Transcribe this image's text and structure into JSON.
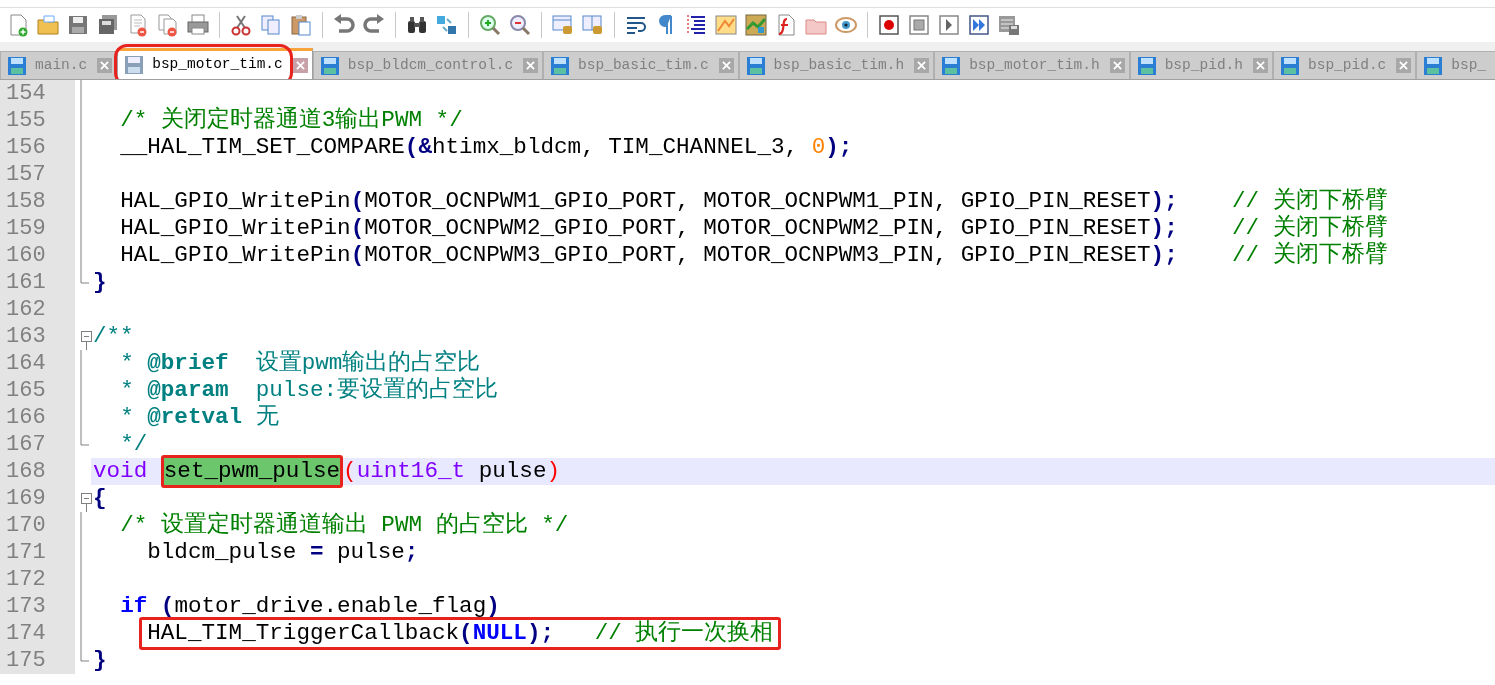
{
  "tabs": [
    {
      "label": "main.c",
      "selected": false,
      "annotated": false,
      "close_button": true
    },
    {
      "label": "bsp_motor_tim.c",
      "selected": true,
      "annotated": true,
      "close_button": true
    },
    {
      "label": "bsp_bldcm_control.c",
      "selected": false,
      "annotated": false,
      "close_button": true
    },
    {
      "label": "bsp_basic_tim.c",
      "selected": false,
      "annotated": false,
      "close_button": true
    },
    {
      "label": "bsp_basic_tim.h",
      "selected": false,
      "annotated": false,
      "close_button": true
    },
    {
      "label": "bsp_motor_tim.h",
      "selected": false,
      "annotated": false,
      "close_button": true
    },
    {
      "label": "bsp_pid.h",
      "selected": false,
      "annotated": false,
      "close_button": true
    },
    {
      "label": "bsp_pid.c",
      "selected": false,
      "annotated": false,
      "close_button": true
    },
    {
      "label": "bsp_",
      "selected": false,
      "annotated": false,
      "close_button": false
    }
  ],
  "editor": {
    "lines": [
      {
        "number": "154",
        "kind": "fold-line",
        "current": false
      },
      {
        "number": "155",
        "kind": "fold-line",
        "current": false,
        "tokens": [
          {
            "kind": "comment",
            "text": "  /* 关闭定时器通道3输出PWM */"
          }
        ]
      },
      {
        "number": "156",
        "kind": "fold-line",
        "current": false,
        "tokens": [
          {
            "kind": "text",
            "text": "  __HAL_TIM_SET_COMPARE"
          },
          {
            "kind": "op",
            "text": "(&"
          },
          {
            "kind": "text",
            "text": "htimx_bldcm, TIM_CHANNEL_3, "
          },
          {
            "kind": "number",
            "text": "0"
          },
          {
            "kind": "op",
            "text": ");"
          }
        ]
      },
      {
        "number": "157",
        "kind": "fold-line",
        "current": false
      },
      {
        "number": "158",
        "kind": "fold-line",
        "current": false,
        "tokens": [
          {
            "kind": "text",
            "text": "  HAL_GPIO_WritePin"
          },
          {
            "kind": "op",
            "text": "("
          },
          {
            "kind": "text",
            "text": "MOTOR_OCNPWM1_GPIO_PORT, MOTOR_OCNPWM1_PIN, GPIO_PIN_RESET"
          },
          {
            "kind": "op",
            "text": ");"
          },
          {
            "kind": "comment",
            "text": "    // 关闭下桥臂"
          }
        ]
      },
      {
        "number": "159",
        "kind": "fold-line",
        "current": false,
        "tokens": [
          {
            "kind": "text",
            "text": "  HAL_GPIO_WritePin"
          },
          {
            "kind": "op",
            "text": "("
          },
          {
            "kind": "text",
            "text": "MOTOR_OCNPWM2_GPIO_PORT, MOTOR_OCNPWM2_PIN, GPIO_PIN_RESET"
          },
          {
            "kind": "op",
            "text": ");"
          },
          {
            "kind": "comment",
            "text": "    // 关闭下桥臂"
          }
        ]
      },
      {
        "number": "160",
        "kind": "fold-line",
        "current": false,
        "tokens": [
          {
            "kind": "text",
            "text": "  HAL_GPIO_WritePin"
          },
          {
            "kind": "op",
            "text": "("
          },
          {
            "kind": "text",
            "text": "MOTOR_OCNPWM3_GPIO_PORT, MOTOR_OCNPWM3_PIN, GPIO_PIN_RESET"
          },
          {
            "kind": "op",
            "text": ");"
          },
          {
            "kind": "comment",
            "text": "    // 关闭下桥臂"
          }
        ]
      },
      {
        "number": "161",
        "kind": "fold-end",
        "current": false,
        "tokens": [
          {
            "kind": "op",
            "text": "}"
          }
        ]
      },
      {
        "number": "162",
        "kind": "plain",
        "current": false
      },
      {
        "number": "163",
        "kind": "fold-start",
        "current": false,
        "tokens": [
          {
            "kind": "doc",
            "text": "/**"
          }
        ]
      },
      {
        "number": "164",
        "kind": "fold-line",
        "current": false,
        "tokens": [
          {
            "kind": "doc",
            "text": "  * "
          },
          {
            "kind": "doctag",
            "text": "@brief"
          },
          {
            "kind": "doc",
            "text": "  设置pwm输出的占空比"
          }
        ]
      },
      {
        "number": "165",
        "kind": "fold-line",
        "current": false,
        "tokens": [
          {
            "kind": "doc",
            "text": "  * "
          },
          {
            "kind": "doctag",
            "text": "@param"
          },
          {
            "kind": "doc",
            "text": "  pulse:要设置的占空比"
          }
        ]
      },
      {
        "number": "166",
        "kind": "fold-line",
        "current": false,
        "tokens": [
          {
            "kind": "doc",
            "text": "  * "
          },
          {
            "kind": "doctag",
            "text": "@retval"
          },
          {
            "kind": "doc",
            "text": " 无"
          }
        ]
      },
      {
        "number": "167",
        "kind": "fold-end",
        "current": false,
        "tokens": [
          {
            "kind": "doc",
            "text": "  */"
          }
        ]
      },
      {
        "number": "168",
        "kind": "plain",
        "current": true,
        "tokens": [
          {
            "kind": "type",
            "text": "void "
          },
          {
            "kind": "found",
            "text": "set_pwm_pulse",
            "annotated": true
          },
          {
            "kind": "match",
            "text": "("
          },
          {
            "kind": "type",
            "text": "uint16_t "
          },
          {
            "kind": "text",
            "text": "pulse"
          },
          {
            "kind": "match",
            "text": ")"
          }
        ]
      },
      {
        "number": "169",
        "kind": "fold-start",
        "current": false,
        "tokens": [
          {
            "kind": "op",
            "text": "{"
          }
        ]
      },
      {
        "number": "170",
        "kind": "fold-line",
        "current": false,
        "tokens": [
          {
            "kind": "comment",
            "text": "  /* 设置定时器通道输出 PWM 的占空比 */"
          }
        ]
      },
      {
        "number": "171",
        "kind": "fold-line",
        "current": false,
        "tokens": [
          {
            "kind": "text",
            "text": "    bldcm_pulse "
          },
          {
            "kind": "op",
            "text": "="
          },
          {
            "kind": "text",
            "text": " pulse"
          },
          {
            "kind": "op",
            "text": ";"
          }
        ]
      },
      {
        "number": "172",
        "kind": "fold-line",
        "current": false
      },
      {
        "number": "173",
        "kind": "fold-line",
        "current": false,
        "tokens": [
          {
            "kind": "keyword",
            "text": "  if"
          },
          {
            "kind": "op",
            "text": " ("
          },
          {
            "kind": "text",
            "text": "motor_drive.enable_flag"
          },
          {
            "kind": "op",
            "text": ")"
          }
        ]
      },
      {
        "number": "174",
        "kind": "fold-line",
        "current": false,
        "annotated": true,
        "tokens": [
          {
            "kind": "text",
            "text": "    HAL_TIM_TriggerCallback"
          },
          {
            "kind": "op",
            "text": "("
          },
          {
            "kind": "keyword",
            "text": "NULL"
          },
          {
            "kind": "op",
            "text": ");"
          },
          {
            "kind": "comment",
            "text": "   // 执行一次换相"
          }
        ]
      },
      {
        "number": "175",
        "kind": "fold-end",
        "current": false,
        "tokens": [
          {
            "kind": "op",
            "text": "}"
          }
        ]
      }
    ]
  }
}
